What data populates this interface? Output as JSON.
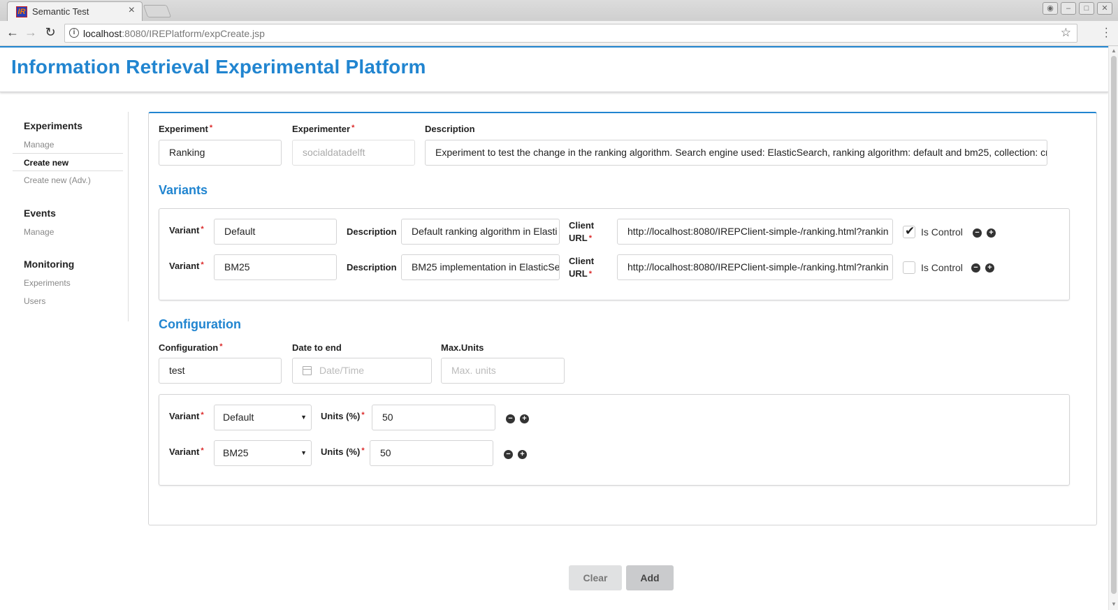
{
  "browser": {
    "tab_title": "Semantic Test",
    "favicon": "IR",
    "url_host": "localhost",
    "url_rest": ":8080/IREPlatform/expCreate.jsp"
  },
  "header": {
    "title": "Information Retrieval Experimental Platform"
  },
  "sidebar": {
    "experiments_head": "Experiments",
    "experiments_items": [
      "Manage",
      "Create new",
      "Create new (Adv.)"
    ],
    "events_head": "Events",
    "events_items": [
      "Manage"
    ],
    "monitoring_head": "Monitoring",
    "monitoring_items": [
      "Experiments",
      "Users"
    ]
  },
  "experiment": {
    "experiment_label": "Experiment",
    "experiment_value": "Ranking",
    "experimenter_label": "Experimenter",
    "experimenter_value": "socialdatadelft",
    "description_label": "Description",
    "description_value": "Experiment to test the change in the ranking algorithm. Search engine used: ElasticSearch, ranking algorithm: default and bm25, collection: cran (h"
  },
  "variants": {
    "title": "Variants",
    "variant_label": "Variant",
    "description_label": "Description",
    "client_label_1": "Client",
    "client_label_2": "URL",
    "is_control_label": "Is Control",
    "rows": [
      {
        "variant": "Default",
        "description": "Default ranking algorithm in Elasti",
        "client_url": "http://localhost:8080/IREPClient-simple-/ranking.html?rankin",
        "is_control": true
      },
      {
        "variant": "BM25",
        "description": "BM25 implementation in ElasticSe",
        "client_url": "http://localhost:8080/IREPClient-simple-/ranking.html?rankin",
        "is_control": false
      }
    ]
  },
  "configuration": {
    "title": "Configuration",
    "configuration_label": "Configuration",
    "configuration_value": "test",
    "date_label": "Date to end",
    "date_placeholder": "Date/Time",
    "max_units_label": "Max.Units",
    "max_units_placeholder": "Max. units",
    "variant_label": "Variant",
    "units_label": "Units (%)",
    "rows": [
      {
        "variant": "Default",
        "units": "50"
      },
      {
        "variant": "BM25",
        "units": "50"
      }
    ]
  },
  "actions": {
    "clear": "Clear",
    "add": "Add"
  },
  "colors": {
    "accent": "#2185d0",
    "required": "#db2828"
  }
}
